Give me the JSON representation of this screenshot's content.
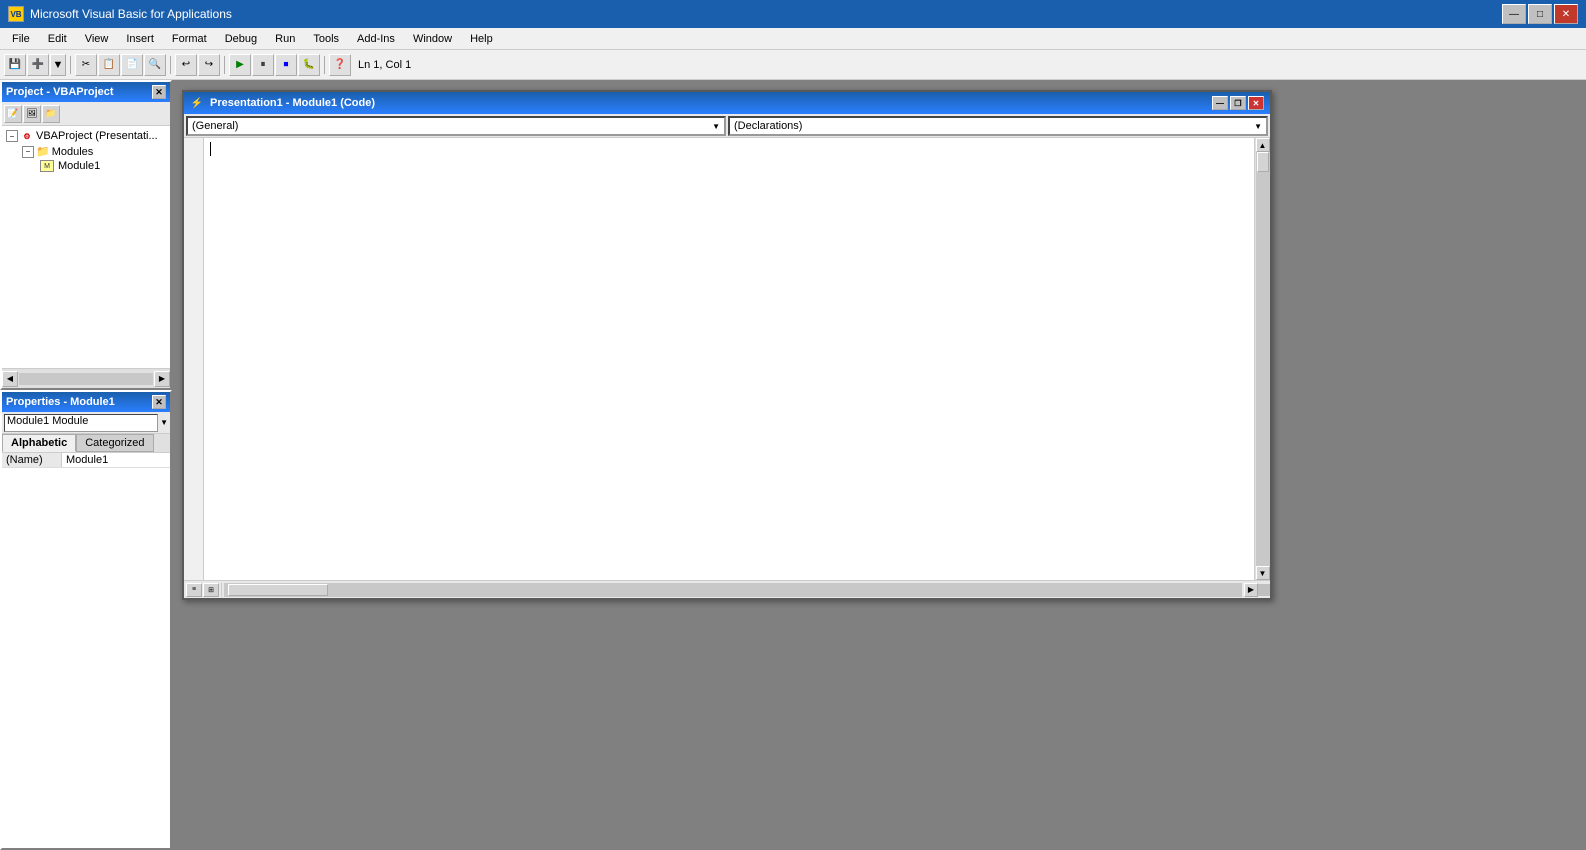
{
  "app": {
    "title": "Microsoft Visual Basic for Applications",
    "icon": "VB"
  },
  "titlebar": {
    "minimize": "—",
    "maximize": "□",
    "close": "✕"
  },
  "menubar": {
    "items": [
      "File",
      "Edit",
      "View",
      "Insert",
      "Format",
      "Debug",
      "Run",
      "Tools",
      "Add-Ins",
      "Window",
      "Help"
    ]
  },
  "toolbar": {
    "status": "Ln 1, Col 1"
  },
  "project_panel": {
    "title": "Project - VBAProject",
    "close": "✕",
    "tree": {
      "vbaproject": "VBAProject (Presentati...",
      "modules_folder": "Modules",
      "module1": "Module1"
    }
  },
  "properties_panel": {
    "title": "Properties - Module1",
    "close": "✕",
    "object": "Module1  Module",
    "tabs": [
      "Alphabetic",
      "Categorized"
    ],
    "active_tab": "Alphabetic",
    "properties": [
      {
        "name": "(Name)",
        "value": "Module1"
      }
    ]
  },
  "code_window": {
    "title": "Presentation1 - Module1 (Code)",
    "minimize": "—",
    "restore": "❐",
    "close": "✕",
    "left_dropdown": "(General)",
    "right_dropdown": "(Declarations)",
    "code_content": ""
  }
}
